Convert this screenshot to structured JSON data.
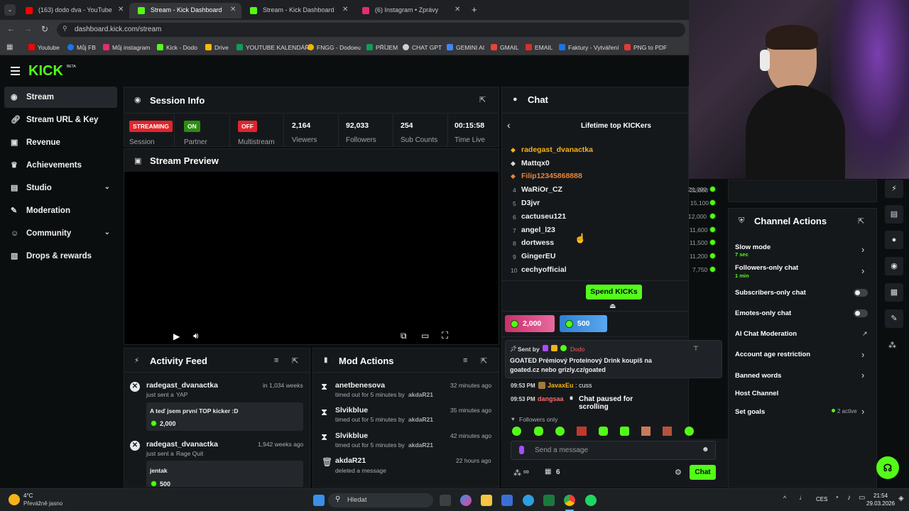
{
  "browser": {
    "tabs": [
      {
        "title": "(163) dodo dva - YouTube",
        "color": "#ff0000"
      },
      {
        "title": "Stream - Kick Dashboard",
        "color": "#53fc18"
      },
      {
        "title": "Stream - Kick Dashboard",
        "color": "#53fc18"
      },
      {
        "title": "(6) Instagram • Zprávy",
        "color": "#e1306c"
      }
    ],
    "new_tab": "+",
    "url": "dashboard.kick.com/stream",
    "bookmarks": [
      {
        "label": "Youtube",
        "color": "#ff0000"
      },
      {
        "label": "Můj FB",
        "color": "#1877f2"
      },
      {
        "label": "Můj instagram",
        "color": "#e1306c"
      },
      {
        "label": "Kick - Dodo",
        "color": "#53fc18"
      },
      {
        "label": "Drive",
        "color": "#fbbc04"
      },
      {
        "label": "YOUTUBE KALENDÁŘ",
        "color": "#0f9d58"
      },
      {
        "label": "FNGG - Dodoeu",
        "color": "#f4b400"
      },
      {
        "label": "PŘÍJEM",
        "color": "#0f9d58"
      },
      {
        "label": "CHAT GPT",
        "color": "#d0d0d0"
      },
      {
        "label": "GEMINI AI",
        "color": "#4285f4"
      },
      {
        "label": "GMAIL",
        "color": "#ea4335"
      },
      {
        "label": "EMAIL",
        "color": "#d93025"
      },
      {
        "label": "Faktury - Vytváření",
        "color": "#1a73e8"
      },
      {
        "label": "PNG to PDF",
        "color": "#e53935"
      }
    ]
  },
  "header": {
    "logo": "KICK",
    "logo_beta": "BETA"
  },
  "sidebar": {
    "items": [
      {
        "label": "Stream",
        "icon": "radio-icon"
      },
      {
        "label": "Stream URL & Key",
        "icon": "link-icon"
      },
      {
        "label": "Revenue",
        "icon": "revenue-icon"
      },
      {
        "label": "Achievements",
        "icon": "trophy-icon"
      },
      {
        "label": "Studio",
        "icon": "studio-icon"
      },
      {
        "label": "Moderation",
        "icon": "wrench-icon"
      },
      {
        "label": "Community",
        "icon": "community-icon"
      },
      {
        "label": "Drops & rewards",
        "icon": "gift-icon"
      }
    ]
  },
  "session": {
    "title": "Session Info",
    "badges": [
      {
        "badge": "STREAMING",
        "label": "Session",
        "color": "#e0252c"
      },
      {
        "badge": "ON",
        "label": "Partner",
        "color": "#2e8b12"
      },
      {
        "badge": "OFF",
        "label": "Multistream",
        "color": "#e0252c"
      }
    ],
    "stats": [
      {
        "value": "2,164",
        "label": "Viewers"
      },
      {
        "value": "92,033",
        "label": "Followers"
      },
      {
        "value": "254",
        "label": "Sub Counts"
      },
      {
        "value": "00:15:58",
        "label": "Time Live"
      }
    ]
  },
  "preview": {
    "title": "Stream Preview"
  },
  "activity": {
    "title": "Activity Feed",
    "items": [
      {
        "user": "radegast_dvanactka",
        "time": "in 1,034 weeks",
        "action_prefix": "just sent a",
        "action": "YAP",
        "message": "A teď jsem první TOP kicker :D",
        "amount": "2,000"
      },
      {
        "user": "radegast_dvanactka",
        "time": "1,942 weeks ago",
        "action_prefix": "just sent a",
        "action": "Rage Quit",
        "message": "jentak",
        "amount": "500"
      }
    ]
  },
  "mod_actions": {
    "title": "Mod Actions",
    "items": [
      {
        "user": "anetbenesova",
        "time": "32 minutes ago",
        "desc": "timed out for 5 minutes by",
        "by": "akdaR21"
      },
      {
        "user": "Slvikblue",
        "time": "35 minutes ago",
        "desc": "timed out for 5 minutes by",
        "by": "akdaR21"
      },
      {
        "user": "Slvikblue",
        "time": "42 minutes ago",
        "desc": "timed out for 5 minutes by",
        "by": "akdaR21"
      },
      {
        "user": "akdaR21",
        "time": "22 hours ago",
        "desc": "deleted a message",
        "by": ""
      }
    ]
  },
  "chat": {
    "title": "Chat",
    "leaderboard_title": "Lifetime top KICKers",
    "top3": [
      {
        "name": "radegast_dvanactka",
        "color": "#f5b21a"
      },
      {
        "name": "Mattqx0",
        "color": "#e8e8e8"
      },
      {
        "name": "Filip12345868888",
        "color": "#e8843a"
      }
    ],
    "ranks": [
      {
        "rank": "4",
        "name": "WaRiOr_CZ",
        "amount": "21,000"
      },
      {
        "rank": "5",
        "name": "D3jvr",
        "amount": "15,100"
      },
      {
        "rank": "6",
        "name": "cactuseu121",
        "amount": "12,000"
      },
      {
        "rank": "7",
        "name": "angel_l23",
        "amount": "11,600"
      },
      {
        "rank": "8",
        "name": "dortwess",
        "amount": "11,500"
      },
      {
        "rank": "9",
        "name": "GingerEU",
        "amount": "11,200"
      },
      {
        "rank": "10",
        "name": "cechyofficial",
        "amount": "7,750"
      }
    ],
    "spend_label": "Spend KICKs",
    "gifts": [
      {
        "amount": "2,000",
        "color": "#c9306b"
      },
      {
        "amount": "500",
        "color": "#2f7fd0"
      }
    ],
    "pinned_sent_by": "Sent by",
    "pinned_user": "Dodo",
    "pinned_text": "GOATED Prémiový Proteinový Drink koupíš na goated.cz nebo grizly.cz/goated",
    "messages": [
      {
        "time": "09:53 PM",
        "user": "JavaxEu",
        "user_color": "#f5b21a",
        "text": ": cuss"
      },
      {
        "time": "09:53 PM",
        "user": "dangsaa",
        "user_color": "#ff6b6b",
        "text": ""
      }
    ],
    "paused": "Chat paused for scrolling",
    "followers_only": "Followers only",
    "input_placeholder": "Send a message",
    "viewers_count": "6",
    "chat_button": "Chat"
  },
  "channel_actions": {
    "title": "Channel Actions",
    "items": [
      {
        "label": "Slow mode",
        "sub": "7 sec",
        "control": "chevron"
      },
      {
        "label": "Followers-only chat",
        "sub": "1 min",
        "control": "chevron"
      },
      {
        "label": "Subscribers-only chat",
        "sub": "",
        "control": "toggle"
      },
      {
        "label": "Emotes-only chat",
        "sub": "",
        "control": "toggle"
      },
      {
        "label": "AI Chat Moderation",
        "sub": "",
        "control": "external"
      },
      {
        "label": "Account age restriction",
        "sub": "",
        "control": "chevron"
      },
      {
        "label": "Banned words",
        "sub": "",
        "control": "chevron"
      },
      {
        "label": "Host Channel",
        "sub": "",
        "control": "none"
      },
      {
        "label": "Set goals",
        "sub": "",
        "control": "chevron",
        "extra": "2 active"
      }
    ]
  },
  "taskbar": {
    "weather_temp": "4°C",
    "weather_desc": "Převážně jasno",
    "search": "Hledat",
    "lang": "CES",
    "time": "21:54",
    "date": "29.03.2026"
  }
}
